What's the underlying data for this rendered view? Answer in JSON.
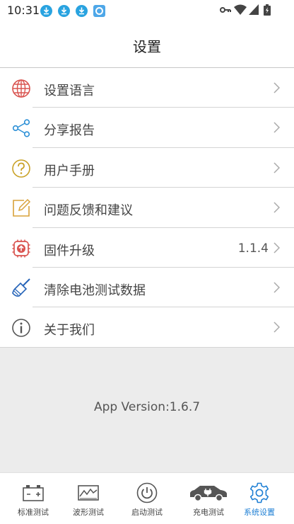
{
  "status_bar": {
    "time": "10:31",
    "left_icons": [
      "download-icon",
      "download-icon",
      "download-icon",
      "app-icon"
    ],
    "right_icons": [
      "key-icon",
      "wifi-icon",
      "signal-icon",
      "battery-icon"
    ]
  },
  "header": {
    "title": "设置"
  },
  "menu": {
    "items": [
      {
        "label": "设置语言",
        "icon": "globe-icon",
        "color": "#d9534f"
      },
      {
        "label": "分享报告",
        "icon": "share-icon",
        "color": "#2b8fd6"
      },
      {
        "label": "用户手册",
        "icon": "help-icon",
        "color": "#c9a227"
      },
      {
        "label": "问题反馈和建议",
        "icon": "edit-icon",
        "color": "#d9a23a"
      },
      {
        "label": "固件升级",
        "icon": "firmware-upgrade-icon",
        "color": "#d9534f",
        "value": "1.1.4"
      },
      {
        "label": "清除电池测试数据",
        "icon": "broom-icon",
        "color": "#2563b8"
      },
      {
        "label": "关于我们",
        "icon": "info-icon",
        "color": "#555555"
      }
    ]
  },
  "version": {
    "text": "App Version:1.6.7"
  },
  "tabbar": {
    "tabs": [
      {
        "label": "标准测试",
        "icon": "battery-test-icon",
        "active": false
      },
      {
        "label": "波形测试",
        "icon": "waveform-icon",
        "active": false
      },
      {
        "label": "启动测试",
        "icon": "power-icon",
        "active": false
      },
      {
        "label": "充电测试",
        "icon": "car-charge-icon",
        "active": false
      },
      {
        "label": "系统设置",
        "icon": "gear-icon",
        "active": true
      }
    ],
    "active_color": "#1e7fd4"
  }
}
